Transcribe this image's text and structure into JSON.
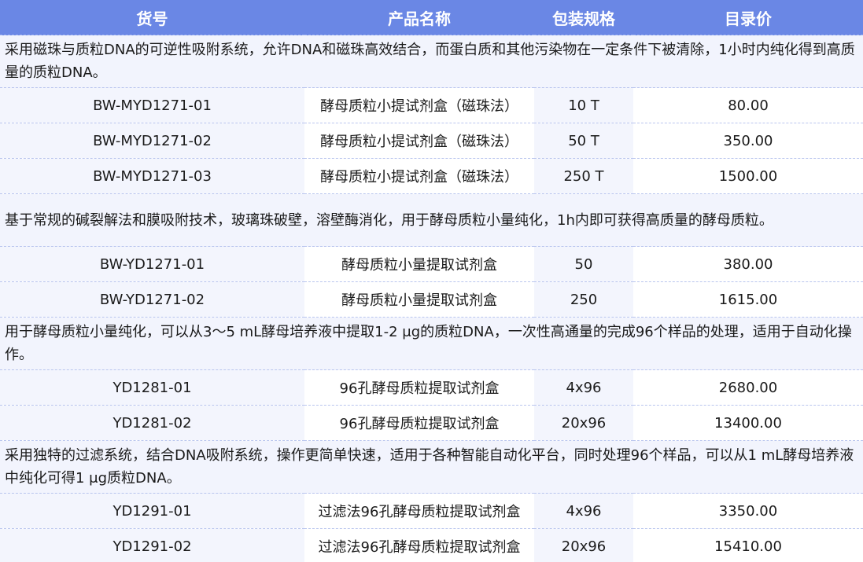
{
  "header": {
    "code": "货号",
    "name": "产品名称",
    "spec": "包装规格",
    "price": "目录价"
  },
  "groups": [
    {
      "description": "采用磁珠与质粒DNA的可逆性吸附系统，允许DNA和磁珠高效结合，而蛋白质和其他污染物在一定条件下被清除，1小时内纯化得到高质量的质粒DNA。",
      "rows": [
        {
          "code": "BW-MYD1271-01",
          "name": "酵母质粒小提试剂盒（磁珠法）",
          "spec": "10 T",
          "price": "80.00"
        },
        {
          "code": "BW-MYD1271-02",
          "name": "酵母质粒小提试剂盒（磁珠法）",
          "spec": "50 T",
          "price": "350.00"
        },
        {
          "code": "BW-MYD1271-03",
          "name": "酵母质粒小提试剂盒（磁珠法）",
          "spec": "250 T",
          "price": "1500.00"
        }
      ]
    },
    {
      "description": "基于常规的碱裂解法和膜吸附技术，玻璃珠破壁，溶壁酶消化，用于酵母质粒小量纯化，1h内即可获得高质量的酵母质粒。",
      "rows": [
        {
          "code": "BW-YD1271-01",
          "name": "酵母质粒小量提取试剂盒",
          "spec": "50",
          "price": "380.00"
        },
        {
          "code": "BW-YD1271-02",
          "name": "酵母质粒小量提取试剂盒",
          "spec": "250",
          "price": "1615.00"
        }
      ]
    },
    {
      "description": "用于酵母质粒小量纯化，可以从3～5 mL酵母培养液中提取1-2 μg的质粒DNA，一次性高通量的完成96个样品的处理，适用于自动化操作。",
      "rows": [
        {
          "code": "YD1281-01",
          "name": "96孔酵母质粒提取试剂盒",
          "spec": "4x96",
          "price": "2680.00"
        },
        {
          "code": "YD1281-02",
          "name": "96孔酵母质粒提取试剂盒",
          "spec": "20x96",
          "price": "13400.00"
        }
      ]
    },
    {
      "description": "采用独特的过滤系统，结合DNA吸附系统，操作更简单快速，适用于各种智能自动化平台，同时处理96个样品，可以从1 mL酵母培养液中纯化可得1 μg质粒DNA。",
      "rows": [
        {
          "code": "YD1291-01",
          "name": "过滤法96孔酵母质粒提取试剂盒",
          "spec": "4x96",
          "price": "3350.00"
        },
        {
          "code": "YD1291-02",
          "name": "过滤法96孔酵母质粒提取试剂盒",
          "spec": "20x96",
          "price": "15410.00"
        }
      ]
    }
  ]
}
